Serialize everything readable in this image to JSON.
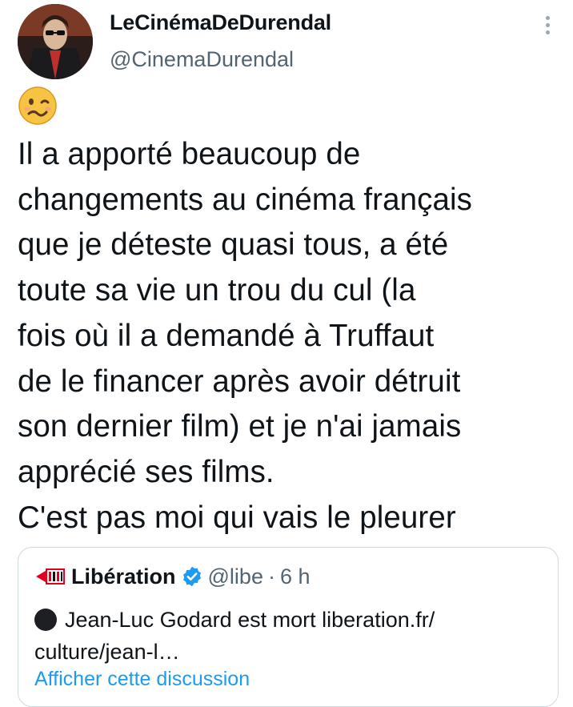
{
  "tweet": {
    "display_name": "LeCinémaDeDurendal",
    "handle": "@CinemaDurendal",
    "emoji": "woozy-face",
    "text_lines": [
      "Il a apporté beaucoup de",
      "changements au cinéma français",
      "que je déteste quasi tous, a été",
      "toute sa vie un trou du cul (la",
      "fois où il a demandé à Truffaut",
      "de le financer après avoir détruit",
      "son dernier film) et je n'ai jamais",
      "apprécié ses films.",
      "C'est pas moi qui vais le pleurer"
    ]
  },
  "quote": {
    "name": "Libération",
    "handle": "@libe",
    "separator": "·",
    "time": "6 h",
    "body": "Jean-Luc Godard est mort liberation.fr/ culture/jean-l…",
    "more_link": "Afficher cette discussion"
  },
  "colors": {
    "text": "#0f1419",
    "secondary": "#536471",
    "link": "#1d9bf0",
    "verified": "#1d9bf0"
  }
}
